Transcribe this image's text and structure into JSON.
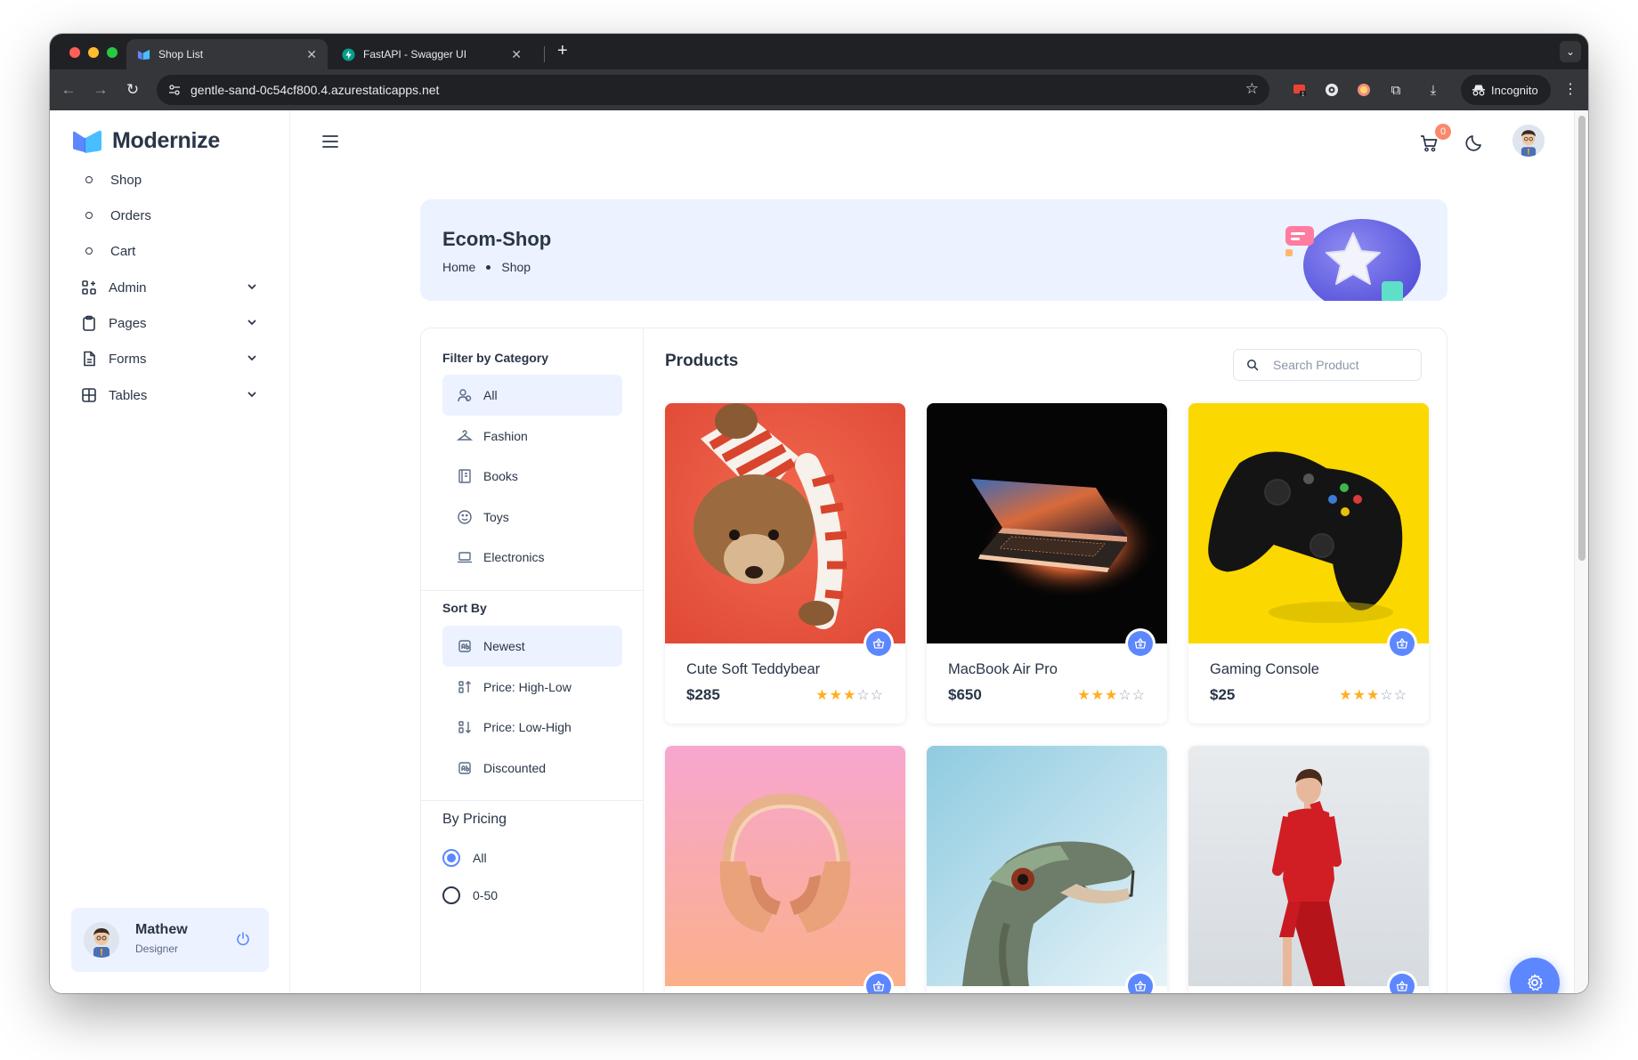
{
  "browser": {
    "tabs": [
      {
        "title": "Shop List",
        "active": true
      },
      {
        "title": "FastAPI - Swagger UI",
        "active": false
      }
    ],
    "url": "gentle-sand-0c54cf800.4.azurestaticapps.net",
    "incognito_label": "Incognito"
  },
  "sidebar": {
    "brand": "Modernize",
    "items": [
      {
        "label": "Shop",
        "icon": "circle-bullet"
      },
      {
        "label": "Orders",
        "icon": "circle-bullet"
      },
      {
        "label": "Cart",
        "icon": "circle-bullet"
      },
      {
        "label": "Admin",
        "icon": "apps-icon",
        "expandable": true
      },
      {
        "label": "Pages",
        "icon": "clipboard-icon",
        "expandable": true
      },
      {
        "label": "Forms",
        "icon": "file-text-icon",
        "expandable": true
      },
      {
        "label": "Tables",
        "icon": "table-icon",
        "expandable": true
      }
    ],
    "profile": {
      "name": "Mathew",
      "role": "Designer"
    }
  },
  "header": {
    "cart_count": "0"
  },
  "hero": {
    "title": "Ecom-Shop",
    "breadcrumb": [
      "Home",
      "Shop"
    ]
  },
  "filters": {
    "category_title": "Filter by Category",
    "categories": [
      {
        "label": "All",
        "icon": "users-icon",
        "selected": true
      },
      {
        "label": "Fashion",
        "icon": "hanger-icon",
        "selected": false
      },
      {
        "label": "Books",
        "icon": "book-icon",
        "selected": false
      },
      {
        "label": "Toys",
        "icon": "mood-smile-icon",
        "selected": false
      },
      {
        "label": "Electronics",
        "icon": "laptop-icon",
        "selected": false
      }
    ],
    "sort_title": "Sort By",
    "sorts": [
      {
        "label": "Newest",
        "icon": "ad-icon",
        "selected": true
      },
      {
        "label": "Price: High-Low",
        "icon": "sort-desc-icon",
        "selected": false
      },
      {
        "label": "Price: Low-High",
        "icon": "sort-asc-icon",
        "selected": false
      },
      {
        "label": "Discounted",
        "icon": "ad-icon",
        "selected": false
      }
    ],
    "pricing_title": "By Pricing",
    "pricing": [
      {
        "label": "All",
        "checked": true
      },
      {
        "label": "0-50",
        "checked": false
      }
    ]
  },
  "products": {
    "title": "Products",
    "search_placeholder": "Search Product",
    "items": [
      {
        "name": "Cute Soft Teddybear",
        "price": "$285",
        "rating": 3
      },
      {
        "name": "MacBook Air Pro",
        "price": "$650",
        "rating": 3
      },
      {
        "name": "Gaming Console",
        "price": "$25",
        "rating": 3
      },
      {
        "name": "",
        "price": "",
        "rating": 0
      },
      {
        "name": "",
        "price": "",
        "rating": 0
      },
      {
        "name": "",
        "price": "",
        "rating": 0
      }
    ]
  },
  "colors": {
    "primary": "#5d87ff",
    "primary_light": "#ecf2ff",
    "text": "#2a3547",
    "star": "#ffae1f",
    "badge": "#fa896b"
  }
}
